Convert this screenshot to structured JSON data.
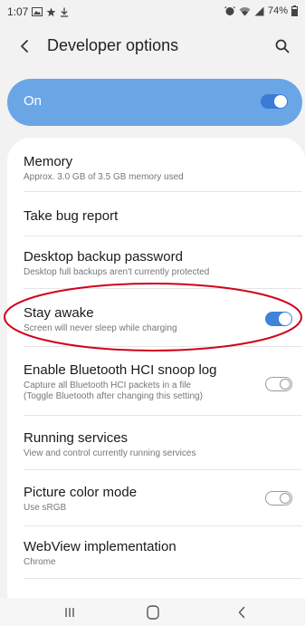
{
  "status_bar": {
    "time": "1:07",
    "battery": "74%",
    "left_icons": [
      "gallery-icon",
      "star-icon",
      "download-icon"
    ],
    "right_icons": [
      "alarm-icon",
      "wifi-icon",
      "signal-icon",
      "battery-icon"
    ]
  },
  "header": {
    "title": "Developer options",
    "back_icon": "back-chevron-icon",
    "search_icon": "search-icon"
  },
  "master_switch": {
    "label": "On",
    "state": "on"
  },
  "settings": [
    {
      "title": "Memory",
      "subtitle": "Approx. 3.0 GB of 3.5 GB memory used"
    },
    {
      "title": "Take bug report"
    },
    {
      "title": "Desktop backup password",
      "subtitle": "Desktop full backups aren't currently protected"
    },
    {
      "title": "Stay awake",
      "subtitle": "Screen will never sleep while charging",
      "toggle": "on"
    },
    {
      "title": "Enable Bluetooth HCI snoop log",
      "subtitle_line1": "Capture all Bluetooth HCI packets in a file",
      "subtitle_line2": "(Toggle Bluetooth after changing this setting)",
      "toggle": "off"
    },
    {
      "title": "Running services",
      "subtitle": "View and control currently running services"
    },
    {
      "title": "Picture color mode",
      "subtitle": "Use sRGB",
      "toggle": "off"
    },
    {
      "title": "WebView implementation",
      "subtitle": "Chrome"
    }
  ],
  "nav_bar": {
    "icons": [
      "recents-icon",
      "home-icon",
      "back-icon"
    ]
  },
  "colors": {
    "accent": "#3f84d8",
    "master_card": "#6aa6e6",
    "annotation": "#d0021b",
    "background": "#f2f2f2"
  }
}
